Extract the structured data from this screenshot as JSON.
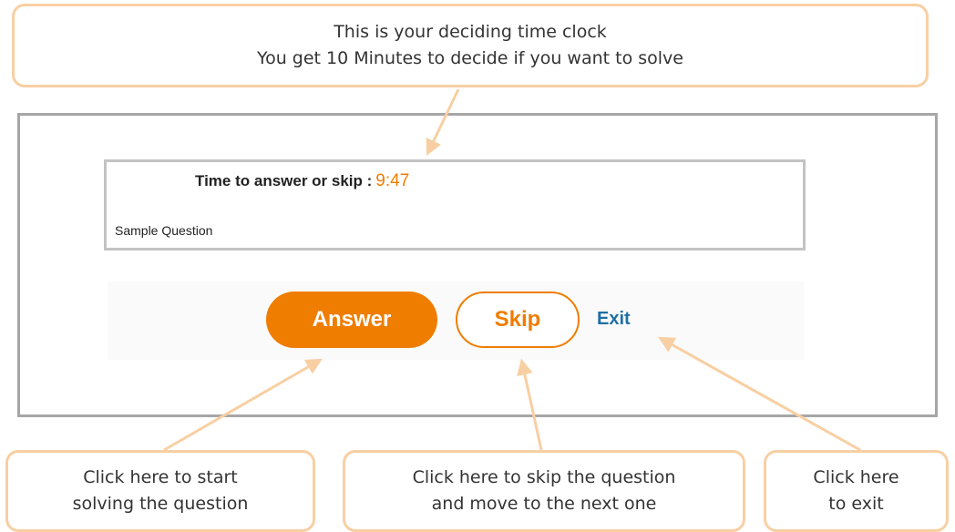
{
  "callouts": {
    "top": {
      "line1": "This is your deciding time clock",
      "line2": "You get 10 Minutes to decide if you want to solve"
    },
    "answer": {
      "line1": "Click here to start",
      "line2": "solving the question"
    },
    "skip": {
      "line1": "Click here to skip the question",
      "line2": "and move to the next one"
    },
    "exit": {
      "line1": "Click here",
      "line2": "to exit"
    }
  },
  "question": {
    "timer_label": "Time to answer or skip :",
    "timer_value": "9:47",
    "text": "Sample Question"
  },
  "buttons": {
    "answer": "Answer",
    "skip": "Skip",
    "exit": "Exit"
  },
  "colors": {
    "accent": "#ef7d00",
    "link": "#1f6fa3",
    "callout_border": "#f8cfa3",
    "frame_border": "#a6a6a6"
  }
}
